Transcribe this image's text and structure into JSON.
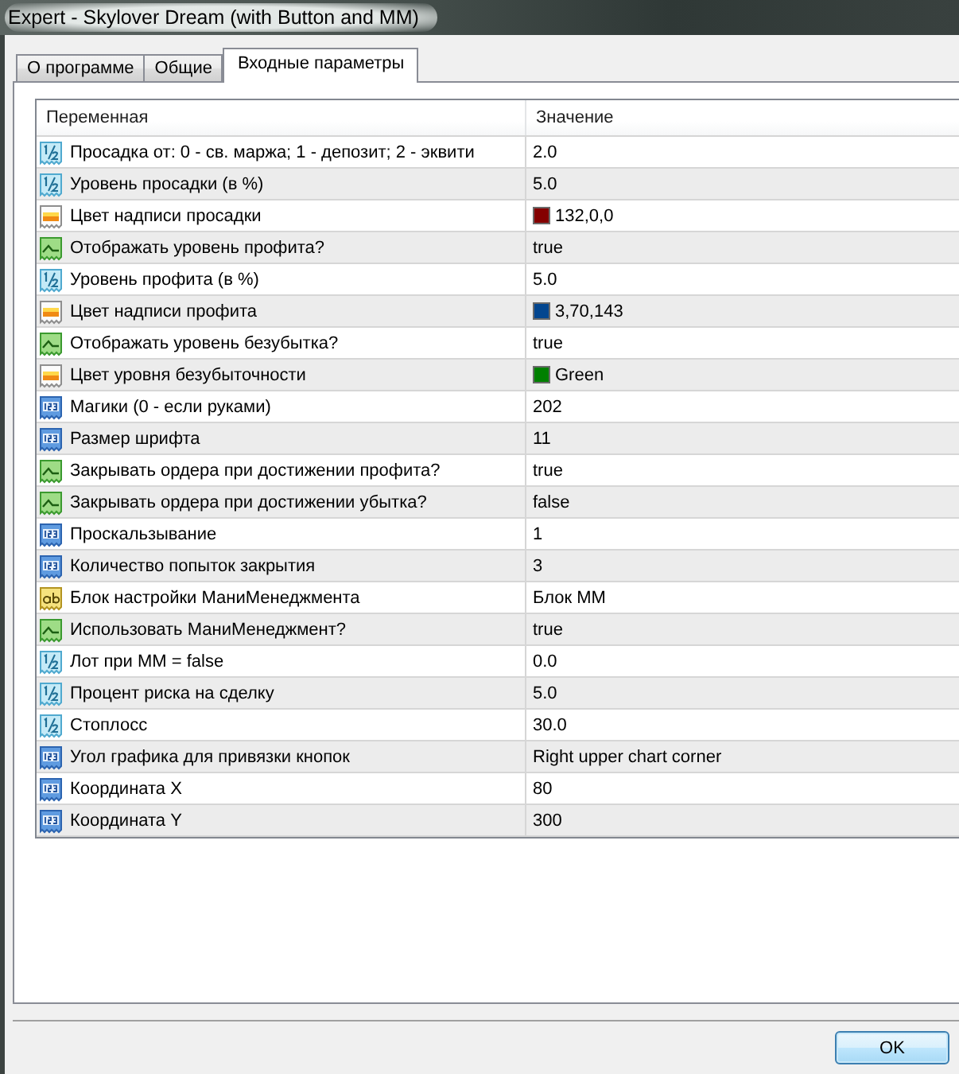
{
  "window": {
    "title": "Expert - Skylover Dream (with Button and MM)"
  },
  "tabs": [
    {
      "label": "О программе",
      "selected": false
    },
    {
      "label": "Общие",
      "selected": false
    },
    {
      "label": "Входные параметры",
      "selected": true
    }
  ],
  "table": {
    "columns": [
      "Переменная",
      "Значение"
    ],
    "rows": [
      {
        "kind": "double",
        "name": "Просадка от: 0 - св. маржа; 1 - депозит; 2 - эквити",
        "value": "2.0"
      },
      {
        "kind": "double",
        "name": "Уровень просадки (в %)",
        "value": "5.0"
      },
      {
        "kind": "color",
        "name": "Цвет надписи просадки",
        "value": "132,0,0",
        "color": "#840000"
      },
      {
        "kind": "bool",
        "name": "Отображать уровень профита?",
        "value": "true"
      },
      {
        "kind": "double",
        "name": "Уровень профита (в %)",
        "value": "5.0"
      },
      {
        "kind": "color",
        "name": "Цвет надписи профита",
        "value": "3,70,143",
        "color": "#03468f"
      },
      {
        "kind": "bool",
        "name": "Отображать уровень безубытка?",
        "value": "true"
      },
      {
        "kind": "color",
        "name": "Цвет уровня безубыточности",
        "value": "Green",
        "color": "#008000"
      },
      {
        "kind": "int",
        "name": "Магики (0 - если руками)",
        "value": "202"
      },
      {
        "kind": "int",
        "name": "Размер шрифта",
        "value": "11"
      },
      {
        "kind": "bool",
        "name": "Закрывать ордера при достижении профита?",
        "value": "true"
      },
      {
        "kind": "bool",
        "name": "Закрывать ордера при достижении убытка?",
        "value": "false"
      },
      {
        "kind": "int",
        "name": "Проскальзывание",
        "value": "1"
      },
      {
        "kind": "int",
        "name": "Количество попыток закрытия",
        "value": "3"
      },
      {
        "kind": "string",
        "name": "Блок настройки МаниМенеджмента",
        "value": "Блок MM"
      },
      {
        "kind": "bool",
        "name": "Использовать МаниМенеджмент?",
        "value": "true"
      },
      {
        "kind": "double",
        "name": "Лот при MM = false",
        "value": "0.0"
      },
      {
        "kind": "double",
        "name": "Процент риска на сделку",
        "value": "5.0"
      },
      {
        "kind": "double",
        "name": "Стоплосс",
        "value": "30.0"
      },
      {
        "kind": "int",
        "name": "Угол графика для привязки кнопок",
        "value": "Right upper chart corner"
      },
      {
        "kind": "int",
        "name": "Координата X",
        "value": "80"
      },
      {
        "kind": "int",
        "name": "Координата Y",
        "value": "300"
      }
    ]
  },
  "buttons": [
    "OK"
  ]
}
